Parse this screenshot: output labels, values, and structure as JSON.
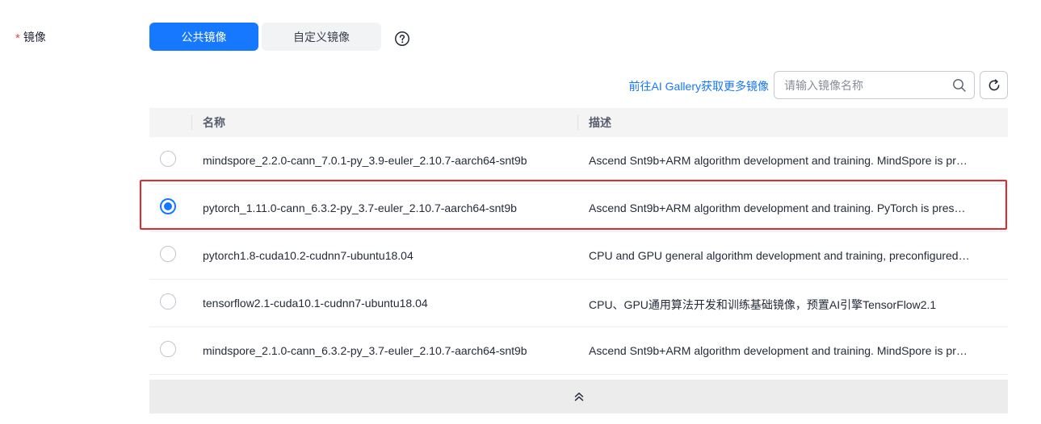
{
  "field": {
    "required_mark": "*",
    "label": "镜像"
  },
  "tabs": [
    {
      "label": "公共镜像",
      "active": true
    },
    {
      "label": "自定义镜像",
      "active": false
    }
  ],
  "toolbar": {
    "gallery_link": "前往AI Gallery获取更多镜像",
    "search_placeholder": "请输入镜像名称",
    "search_value": ""
  },
  "table": {
    "headers": {
      "name": "名称",
      "description": "描述"
    },
    "rows": [
      {
        "name": "mindspore_2.2.0-cann_7.0.1-py_3.9-euler_2.10.7-aarch64-snt9b",
        "description": "Ascend Snt9b+ARM algorithm development and training. MindSpore is pr…",
        "selected": false
      },
      {
        "name": "pytorch_1.11.0-cann_6.3.2-py_3.7-euler_2.10.7-aarch64-snt9b",
        "description": "Ascend Snt9b+ARM algorithm development and training. PyTorch is pres…",
        "selected": true
      },
      {
        "name": "pytorch1.8-cuda10.2-cudnn7-ubuntu18.04",
        "description": "CPU and GPU general algorithm development and training, preconfigured…",
        "selected": false
      },
      {
        "name": "tensorflow2.1-cuda10.1-cudnn7-ubuntu18.04",
        "description": "CPU、GPU通用算法开发和训练基础镜像，预置AI引擎TensorFlow2.1",
        "selected": false
      },
      {
        "name": "mindspore_2.1.0-cann_6.3.2-py_3.7-euler_2.10.7-aarch64-snt9b",
        "description": "Ascend Snt9b+ARM algorithm development and training. MindSpore is pr…",
        "selected": false
      }
    ]
  },
  "icons": {
    "help": "question-circle-icon",
    "search": "search-icon",
    "refresh": "refresh-icon",
    "collapse": "double-chevron-up-icon"
  },
  "colors": {
    "accent": "#1677ff",
    "highlight_border": "#e8262b",
    "required": "#e5484d"
  }
}
